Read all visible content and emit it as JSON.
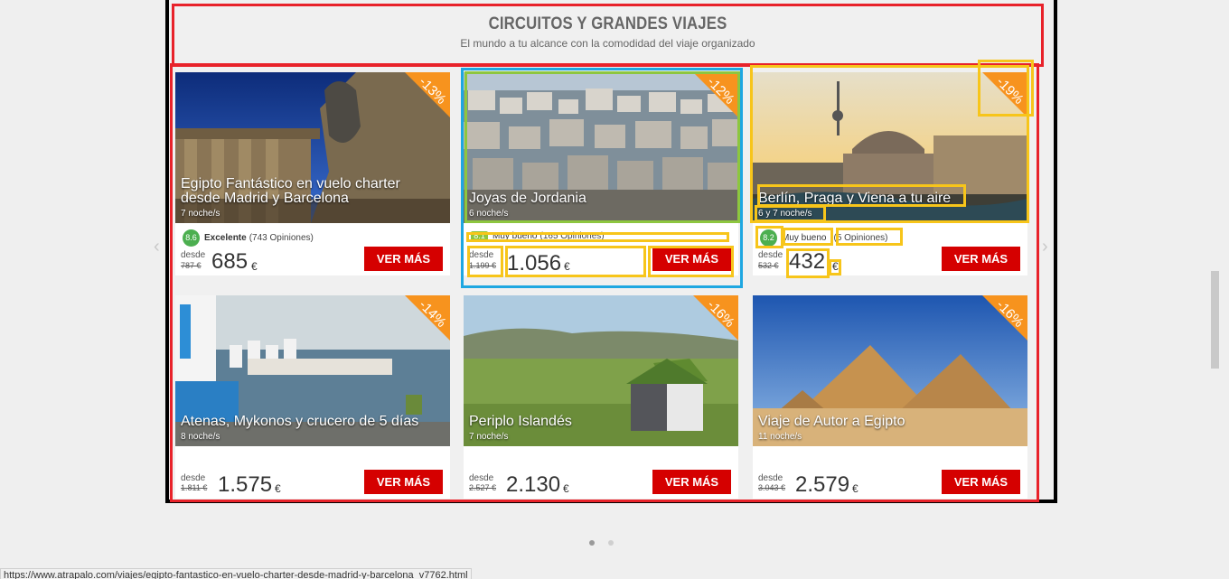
{
  "section": {
    "title": "CIRCUITOS Y GRANDES VIAJES",
    "subtitle": "El mundo a tu alcance con la comodidad del viaje organizado"
  },
  "cards": [
    {
      "name": "Egipto Fantástico en vuelo charter desde Madrid y Barcelona",
      "nights": "7 noche/s",
      "discount": "-13%",
      "score": "8.6",
      "rating_label": "Excelente",
      "opinions": "(743 Opiniones)",
      "desde": "desde",
      "old_price": "787 €",
      "price": "685",
      "currency": "€",
      "button": "VER MÁS"
    },
    {
      "name": "Joyas de Jordania",
      "nights": "6 noche/s",
      "discount": "-12%",
      "score": "8.1",
      "rating_label": "Muy bueno",
      "opinions": "(165 Opiniones)",
      "desde": "desde",
      "old_price": "1.199 €",
      "price": "1.056",
      "currency": "€",
      "button": "VER MÁS"
    },
    {
      "name": "Berlín, Praga y Viena a tu aire",
      "nights": "6 y 7 noche/s",
      "discount": "-19%",
      "score": "8.2",
      "rating_label": "Muy bueno",
      "opinions": "(5 Opiniones)",
      "desde": "desde",
      "old_price": "532 €",
      "price": "432",
      "currency": "€",
      "button": "VER MÁS"
    },
    {
      "name": "Atenas, Mykonos y crucero de 5 días",
      "nights": "8 noche/s",
      "discount": "-14%",
      "desde": "desde",
      "old_price": "1.811 €",
      "price": "1.575",
      "currency": "€",
      "button": "VER MÁS"
    },
    {
      "name": "Periplo Islandés",
      "nights": "7 noche/s",
      "discount": "-16%",
      "desde": "desde",
      "old_price": "2.527 €",
      "price": "2.130",
      "currency": "€",
      "button": "VER MÁS"
    },
    {
      "name": "Viaje de Autor a Egipto",
      "nights": "11 noche/s",
      "discount": "-16%",
      "desde": "desde",
      "old_price": "3.043 €",
      "price": "2.579",
      "currency": "€",
      "button": "VER MÁS"
    }
  ],
  "carousel": {
    "prev_icon": "chevron-left-icon",
    "next_icon": "chevron-right-icon",
    "prev_glyph": "‹",
    "next_glyph": "›",
    "pages": 2,
    "active_page": 1
  },
  "status_bar": {
    "url": "https://www.atrapalo.com/viajes/egipto-fantastico-en-vuelo-charter-desde-madrid-y-barcelona_v7762.html"
  },
  "colors": {
    "accent_red": "#d50000",
    "badge_orange": "#f7931e",
    "score_green": "#4caf50",
    "annotation_red": "#e8222a",
    "annotation_yellow": "#f7c51a",
    "annotation_blue": "#1ea7e1",
    "annotation_green": "#8dc63f"
  }
}
